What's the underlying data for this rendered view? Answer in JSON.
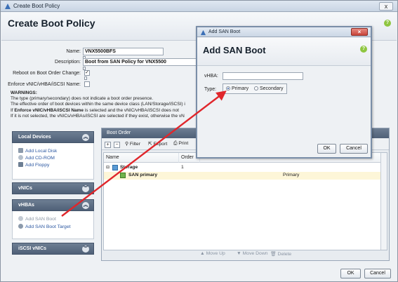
{
  "window": {
    "title": "Create Boot Policy",
    "close_label": "x"
  },
  "header": {
    "title": "Create Boot Policy",
    "help_glyph": "?"
  },
  "form": {
    "name_label": "Name:",
    "name_value": "VNX5500BFS",
    "description_label": "Description:",
    "description_value": "Boot from SAN Policy for VNX5500",
    "reboot_label": "Reboot on Boot Order Change:",
    "reboot_checked": "✓",
    "enforce_label": "Enforce vNIC/vHBA/iSCSI Name:",
    "enforce_checked": ""
  },
  "warnings": {
    "title": "WARNINGS:",
    "line1": "The type (primary/secondary) does not indicate a boot order presence.",
    "line2": "The effective order of boot devices within the same device class (LAN/Storage/iSCSI) i",
    "line3_prefix": "If ",
    "line3_bold": "Enforce vNIC/vHBA/iSCSI Name",
    "line3_suffix": " is selected and the vNIC/vHBA/iSCSI does not",
    "line4": "If it is not selected, the vNICs/vHBAs/iSCSI are selected if they exist, otherwise the vN"
  },
  "sidebar": {
    "local_devices": {
      "title": "Local Devices",
      "items": [
        "Add Local Disk",
        "Add CD-ROM",
        "Add Floppy"
      ]
    },
    "vnics": {
      "title": "vNICs"
    },
    "vhbas": {
      "title": "vHBAs",
      "items": [
        "Add SAN Boot",
        "Add SAN Boot Target"
      ]
    },
    "iscsi": {
      "title": "iSCSI vNICs"
    }
  },
  "boot_order": {
    "title": "Boot Order",
    "toolbar": {
      "filter": "Filter",
      "export": "Export",
      "print": "Print"
    },
    "columns": [
      "Name",
      "Order"
    ],
    "rows": [
      {
        "name": "Storage",
        "order": "1",
        "type": ""
      },
      {
        "name": "SAN primary",
        "order": "",
        "type": "Primary"
      }
    ],
    "footer": {
      "move_up": "Move Up",
      "move_down": "Move Down",
      "delete": "Delete"
    }
  },
  "buttons": {
    "ok": "OK",
    "cancel": "Cancel"
  },
  "san_dialog": {
    "window_title": "Add SAN Boot",
    "heading": "Add SAN Boot",
    "vhba_label": "vHBA:",
    "vhba_value": "",
    "type_label": "Type:",
    "type_options": [
      "Primary",
      "Secondary"
    ],
    "type_selected": "Primary",
    "ok": "OK",
    "cancel": "Cancel"
  },
  "colors": {
    "accent": "#e0262b",
    "header_bar": "#5a6b80",
    "link": "#2a56a0",
    "help": "#8fc640"
  }
}
